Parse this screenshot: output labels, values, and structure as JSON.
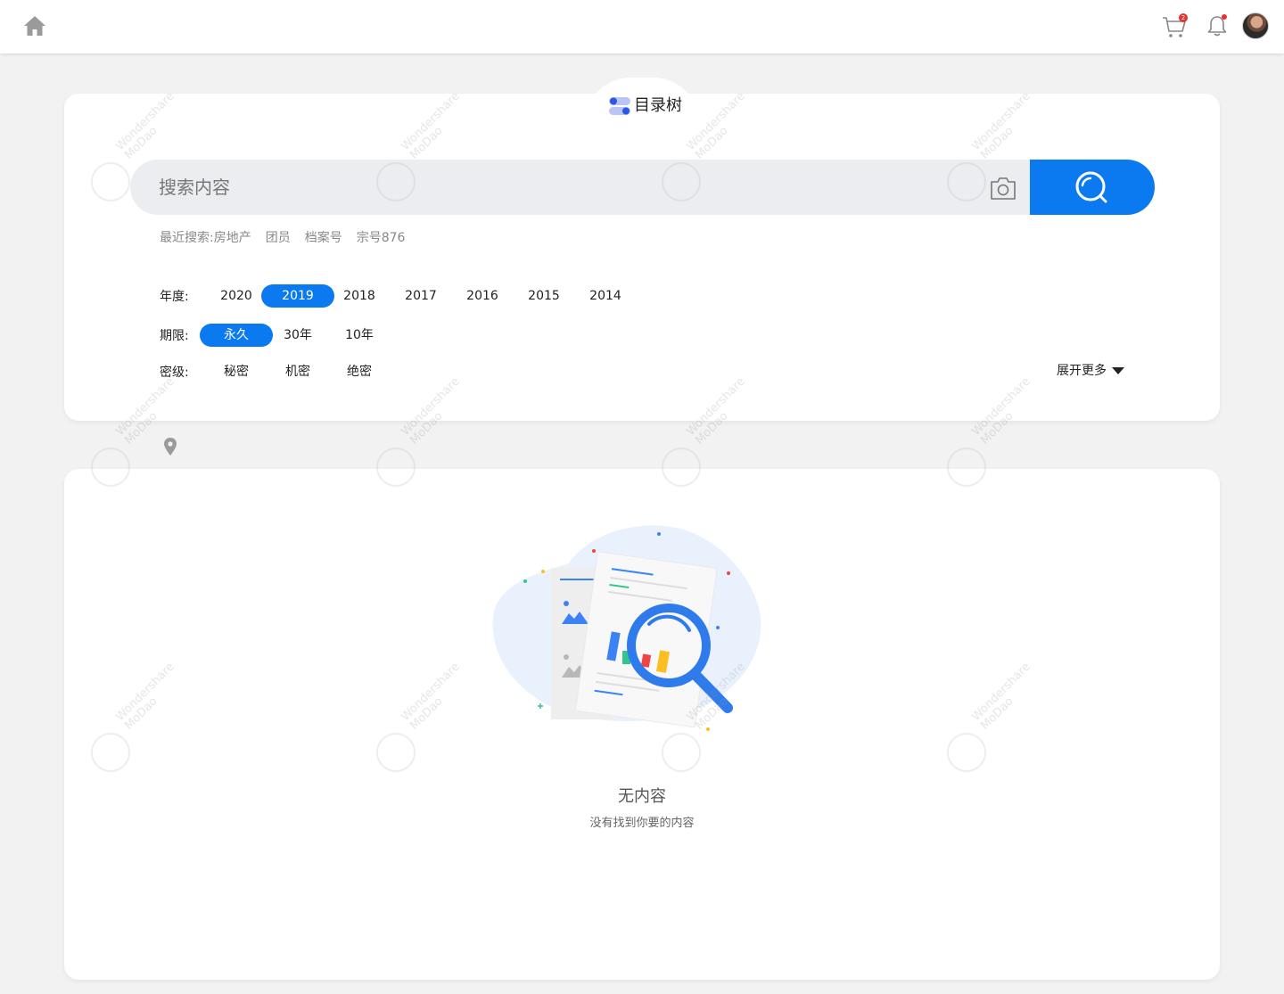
{
  "topbar": {
    "home_icon": "home-icon",
    "cart_icon": "cart-icon",
    "cart_badge": "2",
    "bell_icon": "bell-icon",
    "avatar": "avatar"
  },
  "search_panel": {
    "tree_label": "目录树",
    "search_placeholder": "搜索内容",
    "recent_label": "最近搜索:",
    "recent_items": [
      "房地产",
      "团员",
      "档案号",
      "宗号876"
    ],
    "filters": {
      "year": {
        "label": "年度:",
        "options": [
          "2020",
          "2019",
          "2018",
          "2017",
          "2016",
          "2015",
          "2014"
        ],
        "selected": "2019"
      },
      "term": {
        "label": "期限:",
        "options": [
          "永久",
          "30年",
          "10年"
        ],
        "selected": "永久"
      },
      "secret": {
        "label": "密级:",
        "options": [
          "秘密",
          "机密",
          "绝密"
        ],
        "selected": null
      }
    },
    "expand_more": "展开更多"
  },
  "results": {
    "empty_title": "无内容",
    "empty_subtitle": "没有找到你要的内容"
  },
  "watermark": {
    "line1": "Wondershare",
    "line2": "MoDao"
  },
  "colors": {
    "accent": "#0b79f0",
    "background": "#f2f2f2",
    "badge": "#e8312f"
  }
}
